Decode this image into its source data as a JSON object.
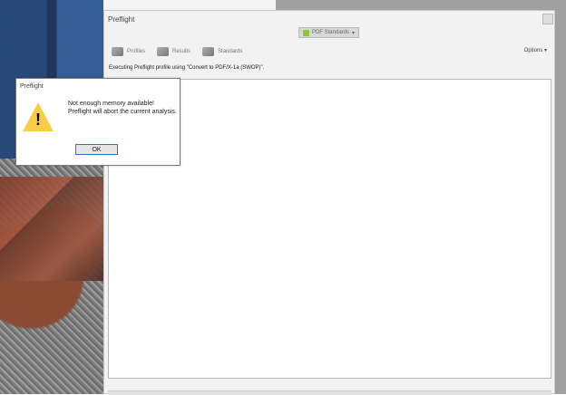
{
  "window": {
    "title": "Preflight",
    "pdf_standards": "PDF Standards",
    "tabs": [
      "Profiles",
      "Results",
      "Standards"
    ],
    "options": "Options",
    "message": "Executing Preflight profile using \"Convert to PDF/X-1a (SWOP)\"."
  },
  "dialog": {
    "title": "Preflight",
    "line1": "Not enough memory available!",
    "line2": "Preflight will abort the current analysis.",
    "ok": "OK"
  }
}
